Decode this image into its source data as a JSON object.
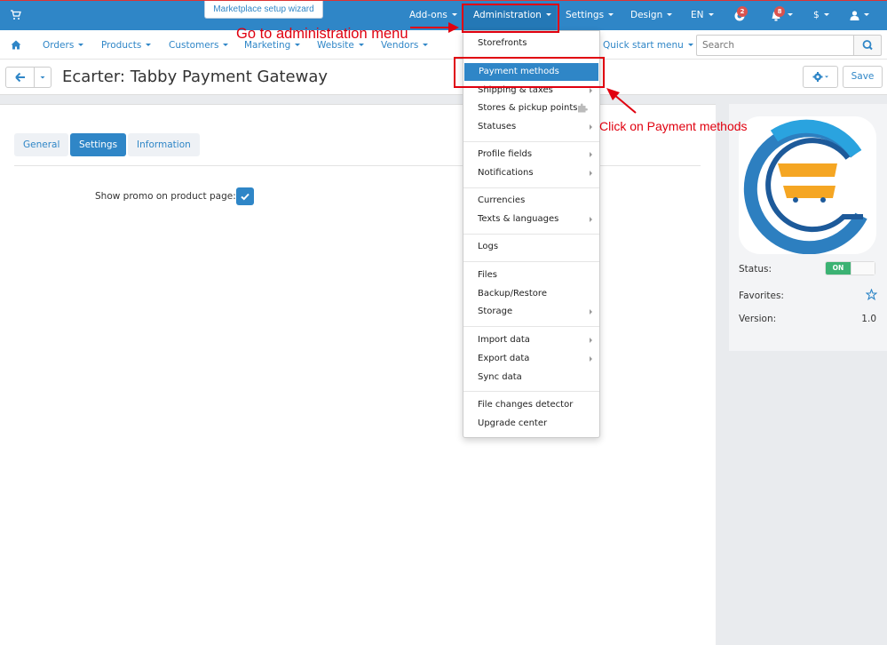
{
  "topbar": {
    "wizard_label": "Marketplace setup wizard",
    "addons": "Add-ons",
    "administration": "Administration",
    "settings": "Settings",
    "design": "Design",
    "language": "EN",
    "help_badge": "2",
    "notif_badge": "8",
    "currency": "$"
  },
  "nav": {
    "orders": "Orders",
    "products": "Products",
    "customers": "Customers",
    "marketing": "Marketing",
    "website": "Website",
    "vendors": "Vendors",
    "quick_start": "Quick start menu",
    "search_placeholder": "Search"
  },
  "page": {
    "title": "Ecarter: Tabby Payment Gateway",
    "save_label": "Save"
  },
  "tabs": [
    "General",
    "Settings",
    "Information"
  ],
  "settings": {
    "promo_label": "Show promo on product page:"
  },
  "sidebar": {
    "status_label": "Status:",
    "status_value": "ON",
    "favorites_label": "Favorites:",
    "version_label": "Version:",
    "version_value": "1.0"
  },
  "dropdown": {
    "items": [
      "Storefronts",
      "Payment methods",
      "Shipping & taxes",
      "Stores & pickup points",
      "Statuses",
      "Profile fields",
      "Notifications",
      "Currencies",
      "Texts & languages",
      "Logs",
      "Files",
      "Backup/Restore",
      "Storage",
      "Import data",
      "Export data",
      "Sync data",
      "File changes detector",
      "Upgrade center"
    ]
  },
  "annotations": {
    "admin_note": "Go to administration menu",
    "payment_note": "Click on Payment methods",
    "color": "#e0000f"
  },
  "colors": {
    "primary": "#2f86c7",
    "on_green": "#3bb273",
    "logo_blue": "#2aa3df",
    "logo_orange": "#f5a623"
  }
}
